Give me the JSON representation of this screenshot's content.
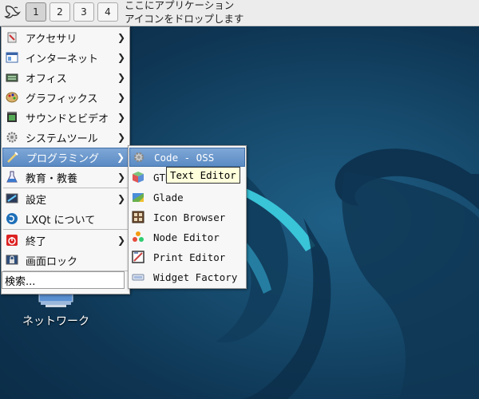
{
  "panel": {
    "desktops": [
      "1",
      "2",
      "3",
      "4"
    ],
    "active_desktop": "1",
    "dropzone_text": [
      "ここにアプリケーション",
      "アイコンをドロップします"
    ]
  },
  "desktop": {
    "icon_label": "ネットワーク"
  },
  "main_menu": {
    "items": [
      {
        "label": "アクセサリ",
        "icon": "accessories-icon",
        "has_submenu": true
      },
      {
        "label": "インターネット",
        "icon": "internet-icon",
        "has_submenu": true
      },
      {
        "label": "オフィス",
        "icon": "office-icon",
        "has_submenu": true
      },
      {
        "label": "グラフィックス",
        "icon": "graphics-icon",
        "has_submenu": true
      },
      {
        "label": "サウンドとビデオ",
        "icon": "sound-video-icon",
        "has_submenu": true
      },
      {
        "label": "システムツール",
        "icon": "system-tools-icon",
        "has_submenu": true
      },
      {
        "label": "プログラミング",
        "icon": "programming-icon",
        "has_submenu": true,
        "highlighted": true
      },
      {
        "label": "教育・教養",
        "icon": "education-icon",
        "has_submenu": true
      },
      {
        "label": "設定",
        "icon": "settings-icon",
        "has_submenu": true
      },
      {
        "label": "LXQt について",
        "icon": "lxqt-icon",
        "has_submenu": false
      },
      {
        "label": "終了",
        "icon": "power-icon",
        "has_submenu": true
      },
      {
        "label": "画面ロック",
        "icon": "lock-screen-icon",
        "has_submenu": false
      }
    ],
    "search_value": "検索..."
  },
  "programming_menu": {
    "items": [
      {
        "label": "Code - OSS",
        "icon": "code-oss-icon",
        "highlighted": true
      },
      {
        "label": "GTK",
        "icon": "gtk-icon"
      },
      {
        "label": "Glade",
        "icon": "glade-icon"
      },
      {
        "label": "Icon Browser",
        "icon": "icon-browser-icon"
      },
      {
        "label": "Node Editor",
        "icon": "node-editor-icon"
      },
      {
        "label": "Print Editor",
        "icon": "print-editor-icon"
      },
      {
        "label": "Widget Factory",
        "icon": "widget-factory-icon"
      }
    ]
  },
  "tooltip": "Text Editor",
  "colors": {
    "highlight": "#5b8bc4",
    "wallpaper": "#164a6c",
    "panel": "#ececec"
  }
}
